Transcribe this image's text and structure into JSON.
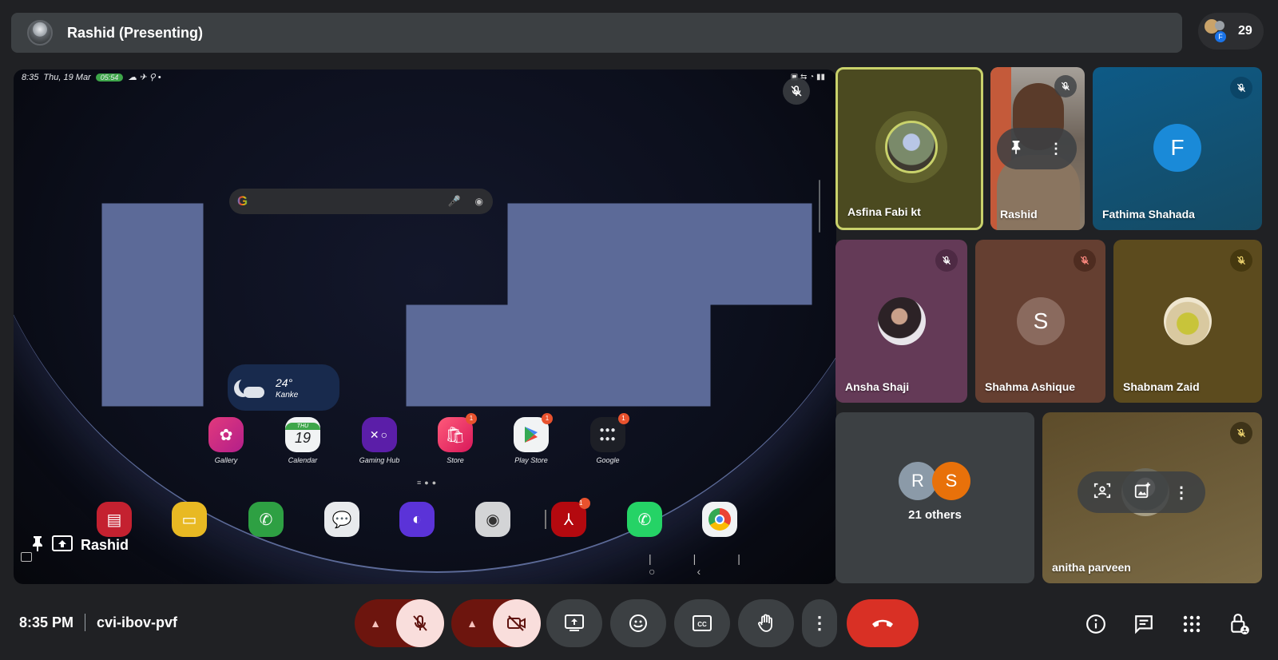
{
  "banner": {
    "title": "Rashid (Presenting)"
  },
  "participants": {
    "count": "29",
    "stack_letter": "F"
  },
  "presentation": {
    "presenter_label": "Rashid",
    "status_bar": {
      "time": "8:35",
      "date": "Thu, 19 Mar",
      "call_pill": "05:54"
    },
    "weather": {
      "temp": "24°",
      "location": "Kanke"
    },
    "calendar_day_abbr": "THU",
    "calendar_date": "19",
    "apps": [
      {
        "label": "Gallery"
      },
      {
        "label": "Calendar"
      },
      {
        "label": "Gaming Hub"
      },
      {
        "label": "Store",
        "badge": "1"
      },
      {
        "label": "Play Store",
        "badge": "1"
      },
      {
        "label": "Google",
        "badge": "1"
      }
    ],
    "dock_badge": "1"
  },
  "tiles": [
    {
      "name": "Asfina Fabi kt"
    },
    {
      "name": "Rashid"
    },
    {
      "name": "Fathima Shahada",
      "letter": "F"
    },
    {
      "name": "Ansha Shaji"
    },
    {
      "name": "Shahma Ashique",
      "letter": "S"
    },
    {
      "name": "Shabnam Zaid"
    },
    {
      "name": "21 others",
      "letters": [
        "R",
        "S"
      ]
    },
    {
      "name": "anitha parveen"
    }
  ],
  "meeting": {
    "time": "8:35 PM",
    "code": "cvi-ibov-pvf"
  },
  "colors": {
    "accent_speaking": "#c9d26b",
    "end_call": "#d93025",
    "muted_bg": "#f9dedc",
    "muted_dark": "#6d150e"
  }
}
